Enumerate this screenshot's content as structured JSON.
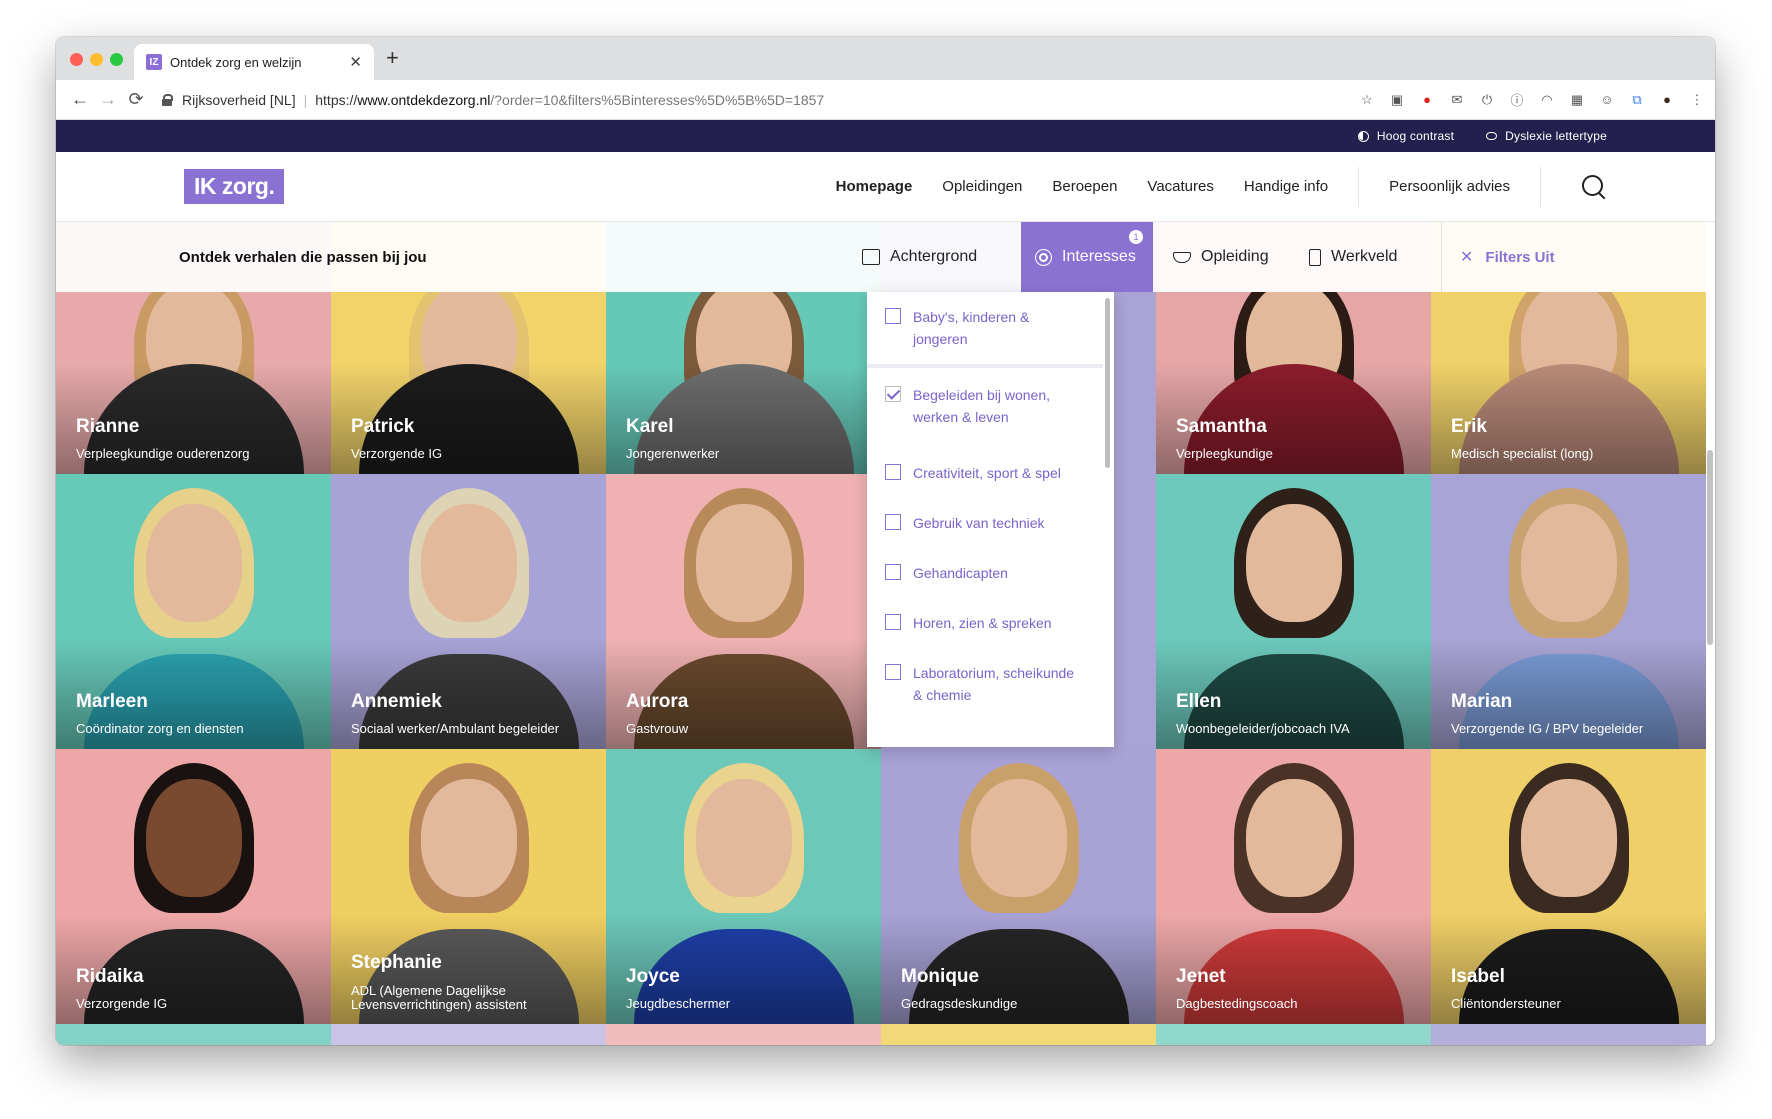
{
  "browser": {
    "tab_title": "Ontdek zorg en welzijn",
    "tab_favicon": "IZ",
    "new_tab": "+",
    "back": "←",
    "forward": "→",
    "reload": "⟳",
    "org_label": "Rijksoverheid [NL]",
    "url_prefix": "https://",
    "url_domain": "www.ontdekdezorg.nl",
    "url_path": "/?order=10&filters%5Binteresses%5D%5B%5D=1857",
    "extension_icons": [
      "star-icon",
      "extension-icon",
      "opera-icon",
      "mail-icon",
      "power-icon",
      "info-icon",
      "arch-icon",
      "grid-icon",
      "face-icon",
      "translate-icon",
      "profile-icon",
      "menu-icon"
    ]
  },
  "utility": {
    "contrast": "Hoog contrast",
    "dyslexia": "Dyslexie lettertype"
  },
  "header": {
    "logo": "IK zorg.",
    "nav": [
      "Homepage",
      "Opleidingen",
      "Beroepen",
      "Vacatures",
      "Handige info"
    ],
    "advice": "Persoonlijk advies"
  },
  "filterbar": {
    "title": "Ontdek verhalen die passen bij jou",
    "achtergrond": "Achtergrond",
    "interesses": "Interesses",
    "interesses_count": "1",
    "opleiding": "Opleiding",
    "werkveld": "Werkveld",
    "clear": "Filters Uit"
  },
  "dropdown": {
    "items": [
      {
        "label": "Baby's, kinderen & jongeren",
        "checked": false
      },
      {
        "label": "Begeleiden bij wonen, werken & leven",
        "checked": true
      },
      {
        "label": "Creativiteit, sport & spel",
        "checked": false
      },
      {
        "label": "Gebruik van techniek",
        "checked": false
      },
      {
        "label": "Gehandicapten",
        "checked": false
      },
      {
        "label": "Horen, zien & spreken",
        "checked": false
      },
      {
        "label": "Laboratorium, scheikunde & chemie",
        "checked": false
      }
    ]
  },
  "people": [
    {
      "name": "Rianne",
      "role": "Verpleegkundige ouderenzorg",
      "bg": "#e7a9a9"
    },
    {
      "name": "Patrick",
      "role": "Verzorgende IG",
      "bg": "#f1d36a"
    },
    {
      "name": "Karel",
      "role": "Jongerenwerker",
      "bg": "#66c9b8"
    },
    {
      "name": "Samantha",
      "role": "Verpleegkundige",
      "bg": "#e6a6a6"
    },
    {
      "name": "Erik",
      "role": "Medisch specialist (long)",
      "bg": "#efd169"
    },
    {
      "name": "Marleen",
      "role": "Coördinator zorg en diensten",
      "bg": "#67c9b8"
    },
    {
      "name": "Annemiek",
      "role": "Sociaal werker/Ambulant begeleider",
      "bg": "#a8a3d6"
    },
    {
      "name": "Aurora",
      "role": "Gastvrouw",
      "bg": "#efb1b1"
    },
    {
      "name": "Ellen",
      "role": "Woonbegeleider/jobcoach IVA",
      "bg": "#6cc9bb"
    },
    {
      "name": "Marian",
      "role": "Verzorgende IG / BPV begeleider",
      "bg": "#a8a4d5"
    },
    {
      "name": "Ridaika",
      "role": "Verzorgende IG",
      "bg": "#eea7a7"
    },
    {
      "name": "Stephanie",
      "role": "ADL (Algemene Dagelijkse Levensverrichtingen) assistent",
      "bg": "#f0cf62"
    },
    {
      "name": "Joyce",
      "role": "Jeugdbeschermer",
      "bg": "#6cc8b9"
    },
    {
      "name": "Monique",
      "role": "Gedragsdeskundige",
      "bg": "#a8a2d6"
    },
    {
      "name": "Jenet",
      "role": "Dagbestedingscoach",
      "bg": "#eda7a7"
    },
    {
      "name": "Isabel",
      "role": "Cliëntondersteuner",
      "bg": "#efcf67"
    }
  ],
  "bottom_row_colors": [
    "#82d2c6",
    "#c9c4e6",
    "#f2bcbc",
    "#f2d978",
    "#8fd6cb",
    "#b4aedb"
  ],
  "colors": {
    "brand_purple": "#8a72d2",
    "utility_bar": "#23204d"
  }
}
